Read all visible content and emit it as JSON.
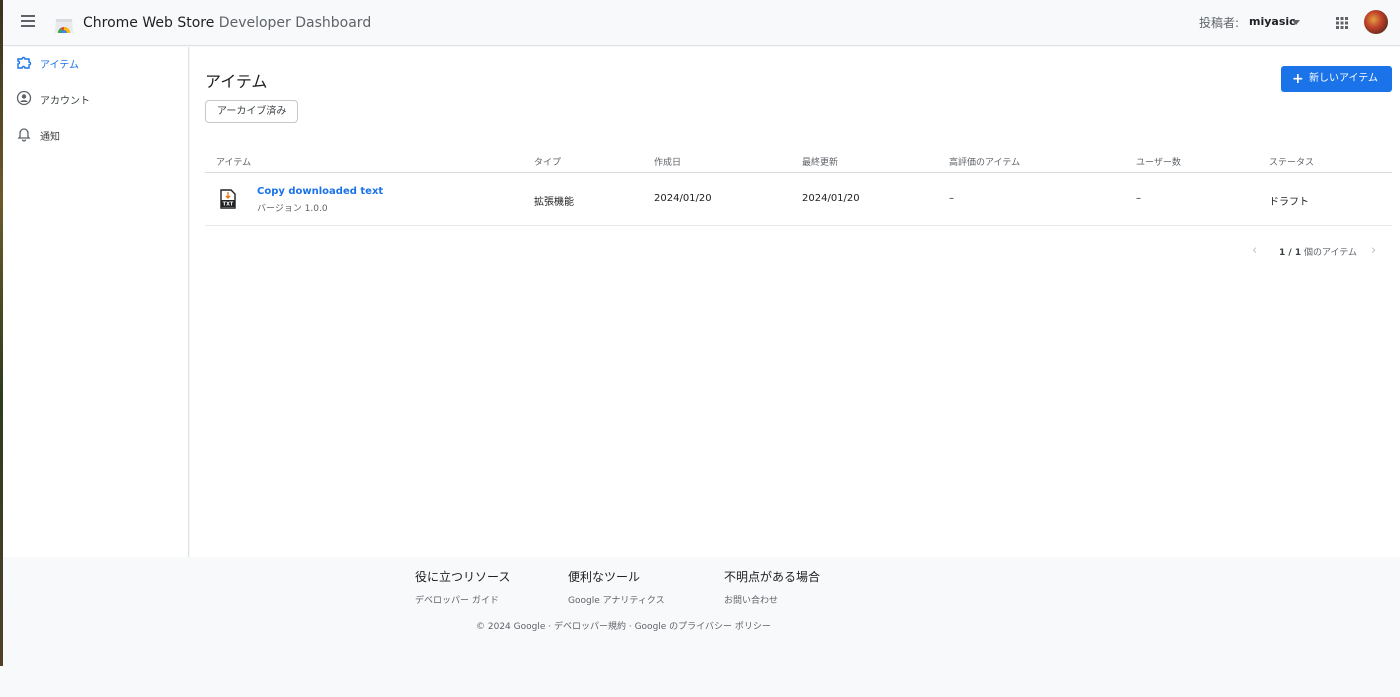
{
  "header": {
    "title_main": "Chrome Web Store",
    "title_sub": " Developer Dashboard",
    "publisher_label": "投稿者:",
    "publisher_value": "miyasic"
  },
  "sidebar": {
    "items": [
      {
        "label": "アイテム",
        "icon": "puzzle-icon",
        "active": true
      },
      {
        "label": "アカウント",
        "icon": "account-circle-icon",
        "active": false
      },
      {
        "label": "通知",
        "icon": "bell-icon",
        "active": false
      }
    ]
  },
  "main": {
    "title": "アイテム",
    "new_item_button": "新しいアイテム",
    "archived_chip": "アーカイブ済み",
    "columns": [
      "アイテム",
      "タイプ",
      "作成日",
      "最終更新",
      "高評価のアイテム",
      "ユーザー数",
      "ステータス"
    ],
    "rows": [
      {
        "name": "Copy downloaded text",
        "version": "バージョン 1.0.0",
        "type": "拡張機能",
        "created": "2024/01/20",
        "updated": "2024/01/20",
        "featured": "–",
        "users": "–",
        "status": "ドラフト"
      }
    ],
    "pager": {
      "range": "1 / 1",
      "suffix": " 個のアイテム"
    }
  },
  "footer": {
    "col1": {
      "heading": "役に立つリソース",
      "link": "デベロッパー ガイド"
    },
    "col2": {
      "heading": "便利なツール",
      "link": "Google アナリティクス"
    },
    "col3": {
      "heading": "不明点がある場合",
      "link": "お問い合わせ"
    },
    "copyright": "© 2024 Google",
    "sep": " · ",
    "terms": "デベロッパー規約",
    "privacy": "Google のプライバシー ポリシー"
  },
  "colors": {
    "accent": "#1a73e8",
    "background": "#f8f9fa"
  }
}
